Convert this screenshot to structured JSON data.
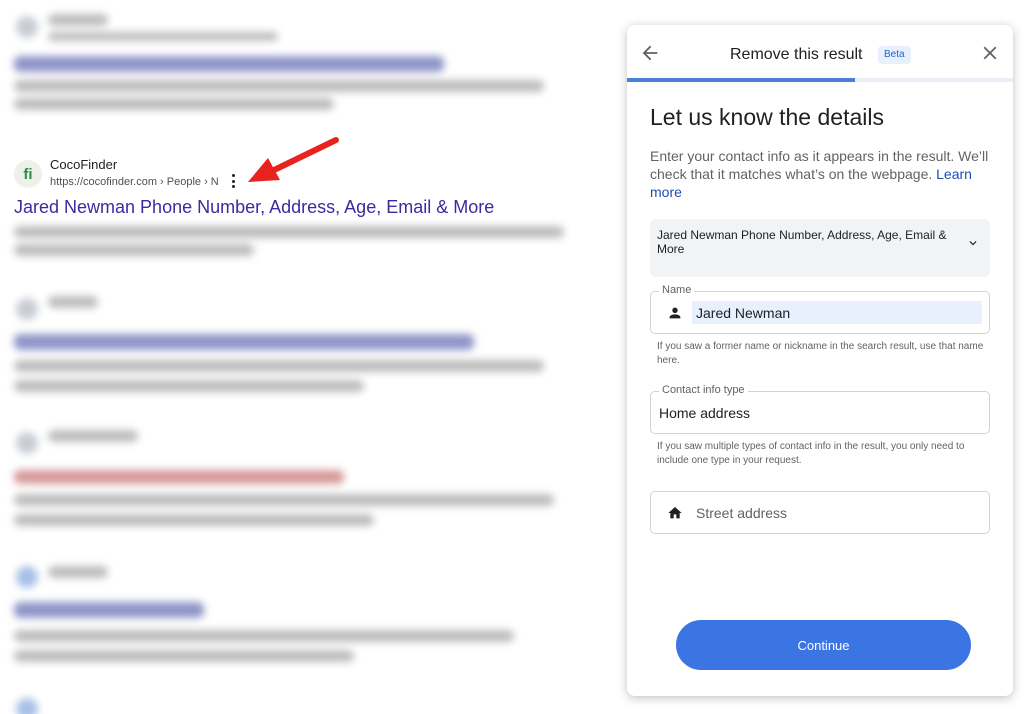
{
  "search_result": {
    "site_name": "CocoFinder",
    "logo_text": "fi",
    "url": "https://cocofinder.com › People › N",
    "title": "Jared Newman Phone Number, Address, Age, Email & More"
  },
  "dialog": {
    "title": "Remove this result",
    "badge": "Beta",
    "progress": 0.59,
    "heading": "Let us know the details",
    "description": "Enter your contact info as it appears in the result. We’ll check that it matches what’s on the webpage.",
    "learn_more": "Learn more",
    "result_select": "Jared Newman Phone Number, Address, Age, Email & More",
    "name_label": "Name",
    "name_value": "Jared Newman",
    "name_hint": "If you saw a former name or nickname in the search result, use that name here.",
    "contact_type_label": "Contact info type",
    "contact_type_value": "Home address",
    "contact_type_hint": "If you saw multiple types of contact info in the result, you only need to include one type in your request.",
    "street_placeholder": "Street address",
    "continue_label": "Continue"
  },
  "colors": {
    "accent": "#3b74e3",
    "progress": "#4a7fdc",
    "link": "#3c2aa0",
    "arrow": "#e8231d"
  },
  "icons": [
    "back-arrow-icon",
    "close-icon",
    "chevron-down-icon",
    "person-icon",
    "home-icon",
    "more-vert-icon",
    "red-arrow-annotation"
  ]
}
